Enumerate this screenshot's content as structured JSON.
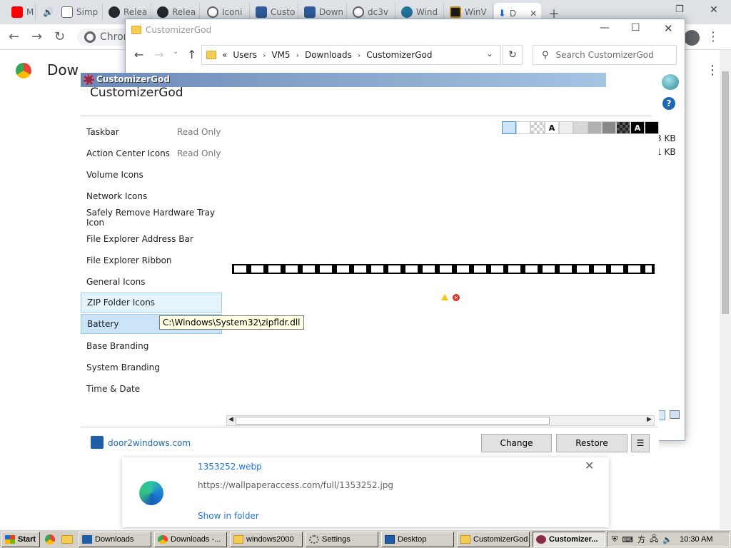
{
  "chrome": {
    "tabs": [
      {
        "label": "M",
        "color": "#ff0000"
      },
      {
        "label": "Simp",
        "color": "#ffffff"
      },
      {
        "label": "Relea",
        "color": "#24292f"
      },
      {
        "label": "Relea",
        "color": "#24292f"
      },
      {
        "label": "Iconi",
        "color": "#5f6368"
      },
      {
        "label": "Custo",
        "color": "#2e5b9a"
      },
      {
        "label": "Down",
        "color": "#2e5b9a"
      },
      {
        "label": "dc3v",
        "color": "#5f6368"
      },
      {
        "label": "Wind",
        "color": "#21759b"
      },
      {
        "label": "WinV",
        "color": "#b8860b"
      },
      {
        "label": "D",
        "color": "#1a73e8"
      }
    ],
    "omnibox_text": "Chron",
    "page_title": "Dow"
  },
  "explorer": {
    "title": "CustomizerGod",
    "address": {
      "lead": "«",
      "crumbs": [
        "Users",
        "VM5",
        "Downloads",
        "CustomizerGod"
      ]
    },
    "search_placeholder": "Search CustomizerGod",
    "sizes": [
      "3 KB",
      "1 KB"
    ]
  },
  "customizer": {
    "title": "CustomizerGod",
    "heading": "CustomizerGod",
    "categories": [
      {
        "label": "Taskbar",
        "note": "Read Only"
      },
      {
        "label": "Action Center Icons",
        "note": "Read Only"
      },
      {
        "label": "Volume Icons",
        "note": ""
      },
      {
        "label": "Network Icons",
        "note": ""
      },
      {
        "label": "Safely Remove Hardware Tray Icon",
        "note": ""
      },
      {
        "label": "File Explorer Address Bar",
        "note": ""
      },
      {
        "label": "File Explorer Ribbon",
        "note": ""
      },
      {
        "label": "General Icons",
        "note": ""
      },
      {
        "label": "ZIP Folder Icons",
        "note": ""
      },
      {
        "label": "Battery",
        "note": ""
      },
      {
        "label": "Base Branding",
        "note": ""
      },
      {
        "label": "System Branding",
        "note": ""
      },
      {
        "label": "Time & Date",
        "note": ""
      }
    ],
    "swatch_letter_light": "A",
    "swatch_letter_dark": "A",
    "tooltip": "C:\\Windows\\System32\\zipfldr.dll",
    "footer_link": "door2windows.com",
    "change_label": "Change",
    "restore_label": "Restore",
    "menu_label": "☰"
  },
  "download": {
    "filename": "1353252.webp",
    "url": "https://wallpaperaccess.com/full/1353252.jpg",
    "show_in_folder": "Show in folder"
  },
  "taskbar": {
    "start_label": "Start",
    "buttons": [
      "Downloads",
      "Downloads -...",
      "windows2000",
      "Settings",
      "Desktop",
      "CustomizerGod",
      "Customizer..."
    ],
    "clock": "10:30 AM"
  },
  "colors": {
    "win_title_gradient_left": "#6b89b6",
    "win_title_gradient_right": "#a6c3e2",
    "selection": "#cce4f7",
    "link_blue": "#1a73e8"
  }
}
